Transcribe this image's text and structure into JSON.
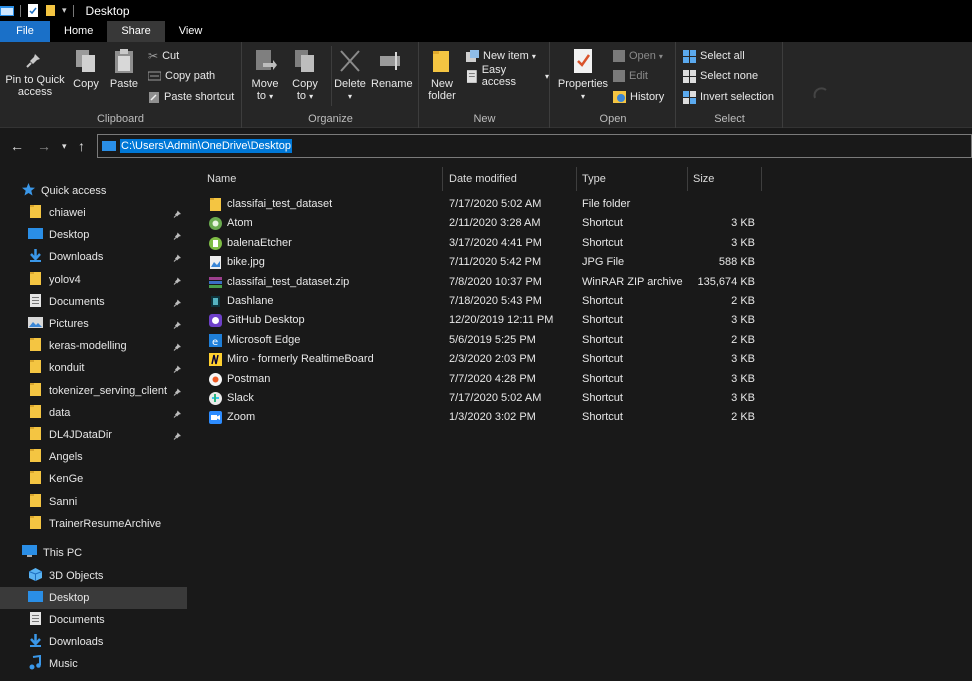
{
  "window": {
    "title": "Desktop"
  },
  "ribbon_tabs": [
    "File",
    "Home",
    "Share",
    "View"
  ],
  "ribbon": {
    "clipboard": {
      "label": "Clipboard",
      "pin_to_quick_access": "Pin to Quick access",
      "copy": "Copy",
      "paste": "Paste",
      "cut": "Cut",
      "copy_path": "Copy path",
      "paste_shortcut": "Paste shortcut"
    },
    "organize": {
      "label": "Organize",
      "move_to": "Move to",
      "copy_to": "Copy to",
      "delete": "Delete",
      "rename": "Rename"
    },
    "new": {
      "label": "New",
      "new_folder": "New folder",
      "new_item": "New item",
      "easy_access": "Easy access"
    },
    "open": {
      "label": "Open",
      "properties": "Properties",
      "open": "Open",
      "edit": "Edit",
      "history": "History"
    },
    "select": {
      "label": "Select",
      "select_all": "Select all",
      "select_none": "Select none",
      "invert_selection": "Invert selection"
    }
  },
  "address": {
    "path": "C:\\Users\\Admin\\OneDrive\\Desktop"
  },
  "navigation": {
    "quick_access_label": "Quick access",
    "quick_access_items": [
      {
        "label": "chiawei",
        "icon": "folder-icon",
        "pinned": true
      },
      {
        "label": "Desktop",
        "icon": "desktop-icon",
        "pinned": true
      },
      {
        "label": "Downloads",
        "icon": "download-icon",
        "pinned": true
      },
      {
        "label": "yolov4",
        "icon": "folder-icon",
        "pinned": true
      },
      {
        "label": "Documents",
        "icon": "documents-icon",
        "pinned": true
      },
      {
        "label": "Pictures",
        "icon": "pictures-icon",
        "pinned": true
      },
      {
        "label": "keras-modelling",
        "icon": "folder-icon",
        "pinned": true
      },
      {
        "label": "konduit",
        "icon": "folder-icon",
        "pinned": true
      },
      {
        "label": "tokenizer_serving_client",
        "icon": "folder-icon",
        "pinned": true
      },
      {
        "label": "data",
        "icon": "folder-icon",
        "pinned": true
      },
      {
        "label": "DL4JDataDir",
        "icon": "folder-icon",
        "pinned": true
      },
      {
        "label": "Angels",
        "icon": "folder-icon",
        "pinned": false
      },
      {
        "label": "KenGe",
        "icon": "folder-icon",
        "pinned": false
      },
      {
        "label": "Sanni",
        "icon": "folder-icon",
        "pinned": false
      },
      {
        "label": "TrainerResumeArchive",
        "icon": "folder-icon",
        "pinned": false
      }
    ],
    "this_pc_label": "This PC",
    "this_pc_items": [
      {
        "label": "3D Objects",
        "icon": "3d-objects-icon"
      },
      {
        "label": "Desktop",
        "icon": "desktop-icon"
      },
      {
        "label": "Documents",
        "icon": "documents-icon"
      },
      {
        "label": "Downloads",
        "icon": "download-icon"
      },
      {
        "label": "Music",
        "icon": "music-icon"
      }
    ]
  },
  "columns": {
    "name": "Name",
    "date_modified": "Date modified",
    "type": "Type",
    "size": "Size"
  },
  "files": [
    {
      "name": "classifai_test_dataset",
      "date": "7/17/2020 5:02 AM",
      "type": "File folder",
      "size": "",
      "icon": "folder-icon"
    },
    {
      "name": "Atom",
      "date": "2/11/2020 3:28 AM",
      "type": "Shortcut",
      "size": "3 KB",
      "icon": "atom-icon"
    },
    {
      "name": "balenaEtcher",
      "date": "3/17/2020 4:41 PM",
      "type": "Shortcut",
      "size": "3 KB",
      "icon": "balena-etcher-icon"
    },
    {
      "name": "bike.jpg",
      "date": "7/11/2020 5:42 PM",
      "type": "JPG File",
      "size": "588 KB",
      "icon": "image-file-icon"
    },
    {
      "name": "classifai_test_dataset.zip",
      "date": "7/8/2020 10:37 PM",
      "type": "WinRAR ZIP archive",
      "size": "135,674 KB",
      "icon": "winrar-icon"
    },
    {
      "name": "Dashlane",
      "date": "7/18/2020 5:43 PM",
      "type": "Shortcut",
      "size": "2 KB",
      "icon": "dashlane-icon"
    },
    {
      "name": "GitHub Desktop",
      "date": "12/20/2019 12:11 PM",
      "type": "Shortcut",
      "size": "3 KB",
      "icon": "github-desktop-icon"
    },
    {
      "name": "Microsoft Edge",
      "date": "5/6/2019 5:25 PM",
      "type": "Shortcut",
      "size": "2 KB",
      "icon": "edge-icon"
    },
    {
      "name": "Miro - formerly RealtimeBoard",
      "date": "2/3/2020 2:03 PM",
      "type": "Shortcut",
      "size": "3 KB",
      "icon": "miro-icon"
    },
    {
      "name": "Postman",
      "date": "7/7/2020 4:28 PM",
      "type": "Shortcut",
      "size": "3 KB",
      "icon": "postman-icon"
    },
    {
      "name": "Slack",
      "date": "7/17/2020 5:02 AM",
      "type": "Shortcut",
      "size": "3 KB",
      "icon": "slack-icon"
    },
    {
      "name": "Zoom",
      "date": "1/3/2020 3:02 PM",
      "type": "Shortcut",
      "size": "2 KB",
      "icon": "zoom-icon"
    }
  ],
  "colors": {
    "accent": "#0078d7",
    "file_tab": "#1a70c8",
    "folder": "#f4c542",
    "background": "#191919"
  }
}
